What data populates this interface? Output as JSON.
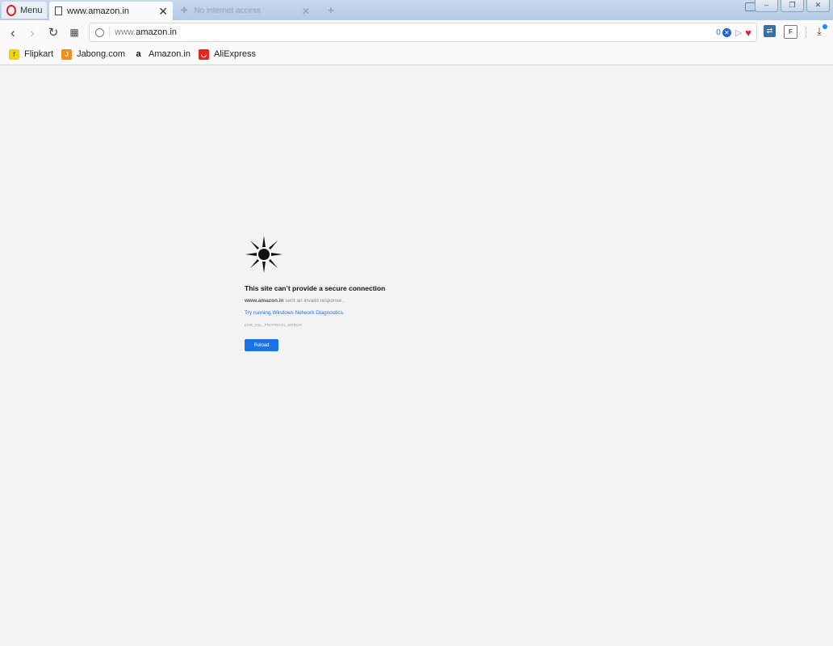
{
  "browser": {
    "menu_label": "Menu",
    "tabs": [
      {
        "title": "www.amazon.in",
        "active": true
      },
      {
        "title": "No internet access",
        "active": false
      }
    ],
    "window_controls": [
      "–",
      "❐",
      "✕"
    ]
  },
  "address_bar": {
    "url_prefix": "www.",
    "url_host": "amazon.in",
    "adblock_count": "0"
  },
  "bookmarks": [
    {
      "label": "Flipkart",
      "icon": "flipkart-icon",
      "badge": "f"
    },
    {
      "label": "Jabong.com",
      "icon": "jabong-icon",
      "badge": "J"
    },
    {
      "label": "Amazon.in",
      "icon": "amazon-icon",
      "badge": "a"
    },
    {
      "label": "AliExpress",
      "icon": "aliexpress-icon",
      "badge": "◡"
    }
  ],
  "error": {
    "icon": "broken-sun-icon",
    "title": "This site can’t provide a secure connection",
    "host": "www.amazon.in",
    "detail_suffix": " sent an invalid response.",
    "diagnostics_link": "Try running Windows Network Diagnostics.",
    "code": "ERR_SSL_PROTOCOL_ERROR",
    "reload_label": "Reload"
  },
  "colors": {
    "accent": "#1a73e8",
    "opera_red": "#d9232d",
    "page_bg": "#f3f3f3"
  }
}
